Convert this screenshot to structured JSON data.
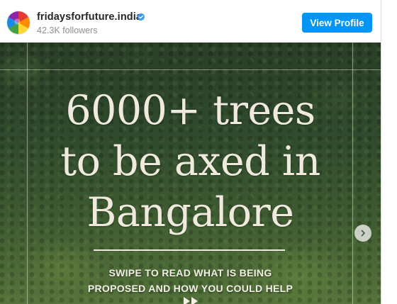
{
  "post_header": {
    "username": "fridaysforfuture.india",
    "followers": "42.3K followers",
    "view_profile_label": "View Profile"
  },
  "post_image": {
    "headline_lines": [
      "6000+ trees",
      "to be axed in",
      "Bangalore"
    ],
    "cta_lines": [
      "SWIPE TO READ WHAT IS BEING",
      "PROPOSED AND HOW YOU COULD HELP"
    ]
  },
  "icons": {
    "verified": "verified-badge-icon",
    "next": "chevron-right-icon",
    "swipe": "double-chevron-right-icon"
  },
  "colors": {
    "accent": "#0095f6",
    "text_primary": "#262626",
    "text_secondary": "#8e8e8e",
    "headline": "#efe9de"
  }
}
